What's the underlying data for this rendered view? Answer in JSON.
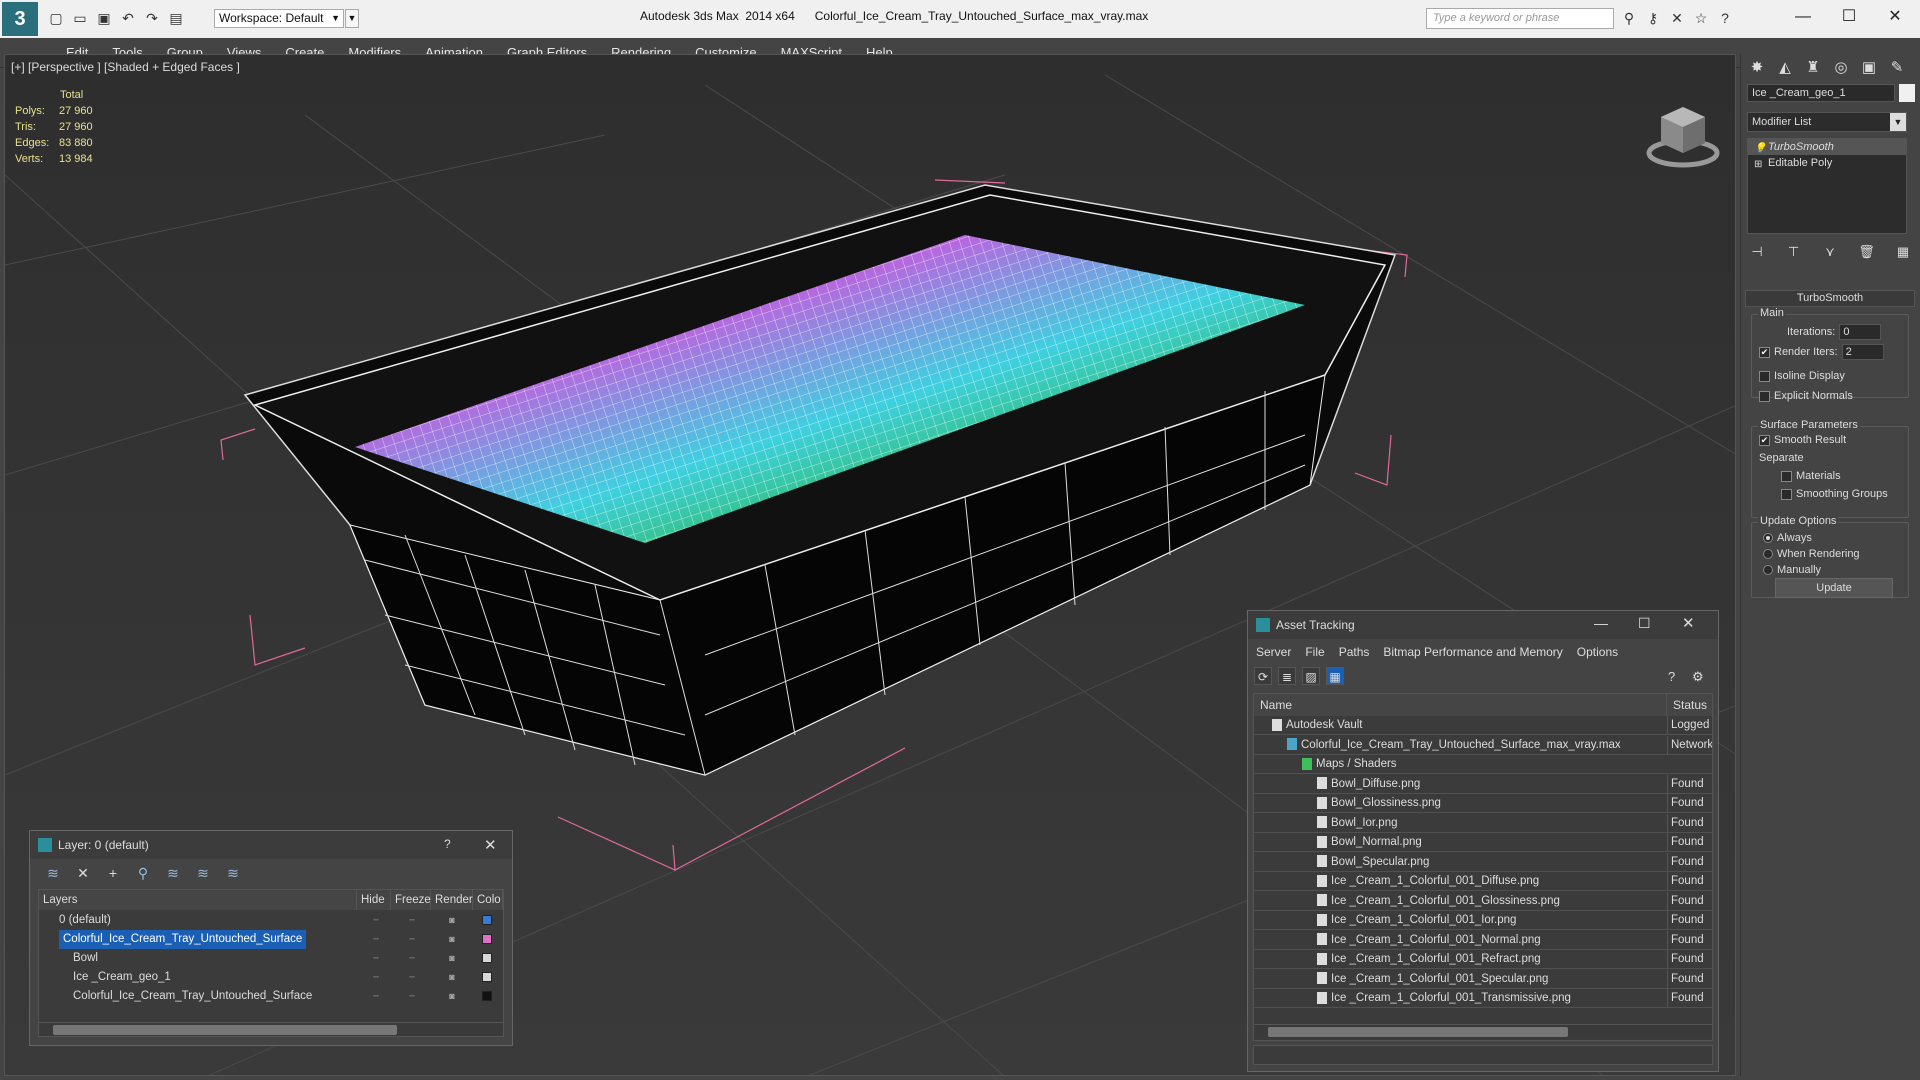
{
  "titlebar": {
    "workspace": "Workspace: Default",
    "app_title": "Autodesk 3ds Max  2014 x64      Colorful_Ice_Cream_Tray_Untouched_Surface_max_vray.max",
    "search_placeholder": "Type a keyword or phrase"
  },
  "menu": [
    "Edit",
    "Tools",
    "Group",
    "Views",
    "Create",
    "Modifiers",
    "Animation",
    "Graph Editors",
    "Rendering",
    "Customize",
    "MAXScript",
    "Help"
  ],
  "viewport": {
    "label": "[+] [Perspective ] [Shaded + Edged Faces ]",
    "stats_header": "Total",
    "stats": [
      {
        "label": "Polys:",
        "value": "27 960"
      },
      {
        "label": "Tris:",
        "value": "27 960"
      },
      {
        "label": "Edges:",
        "value": "83 880"
      },
      {
        "label": "Verts:",
        "value": "13 984"
      }
    ]
  },
  "command_panel": {
    "object_name": "Ice _Cream_geo_1",
    "modifier_list": "Modifier List",
    "stack": [
      "TurboSmooth",
      "Editable Poly"
    ],
    "rollout_title": "TurboSmooth",
    "main_group": "Main",
    "iterations_label": "Iterations:",
    "iterations_value": "0",
    "render_iters_label": "Render Iters:",
    "render_iters_value": "2",
    "isoline": "Isoline Display",
    "explicit_normals": "Explicit Normals",
    "surface_group": "Surface Parameters",
    "smooth_result": "Smooth Result",
    "separate": "Separate",
    "materials": "Materials",
    "smoothing_groups": "Smoothing Groups",
    "update_group": "Update Options",
    "always": "Always",
    "when_rendering": "When Rendering",
    "manually": "Manually",
    "update_button": "Update"
  },
  "asset_tracking": {
    "title": "Asset Tracking",
    "menu": [
      "Server",
      "File",
      "Paths",
      "Bitmap Performance and Memory",
      "Options"
    ],
    "col_name": "Name",
    "col_status": "Status",
    "rows": [
      {
        "name": "Autodesk Vault",
        "status": "Logged",
        "indent": 0
      },
      {
        "name": "Colorful_Ice_Cream_Tray_Untouched_Surface_max_vray.max",
        "status": "Network",
        "indent": 1
      },
      {
        "name": "Maps / Shaders",
        "status": "",
        "indent": 2
      },
      {
        "name": "Bowl_Diffuse.png",
        "status": "Found",
        "indent": 3
      },
      {
        "name": "Bowl_Glossiness.png",
        "status": "Found",
        "indent": 3
      },
      {
        "name": "Bowl_Ior.png",
        "status": "Found",
        "indent": 3
      },
      {
        "name": "Bowl_Normal.png",
        "status": "Found",
        "indent": 3
      },
      {
        "name": "Bowl_Specular.png",
        "status": "Found",
        "indent": 3
      },
      {
        "name": "Ice _Cream_1_Colorful_001_Diffuse.png",
        "status": "Found",
        "indent": 3
      },
      {
        "name": "Ice _Cream_1_Colorful_001_Glossiness.png",
        "status": "Found",
        "indent": 3
      },
      {
        "name": "Ice _Cream_1_Colorful_001_Ior.png",
        "status": "Found",
        "indent": 3
      },
      {
        "name": "Ice _Cream_1_Colorful_001_Normal.png",
        "status": "Found",
        "indent": 3
      },
      {
        "name": "Ice _Cream_1_Colorful_001_Refract.png",
        "status": "Found",
        "indent": 3
      },
      {
        "name": "Ice _Cream_1_Colorful_001_Specular.png",
        "status": "Found",
        "indent": 3
      },
      {
        "name": "Ice _Cream_1_Colorful_001_Transmissive.png",
        "status": "Found",
        "indent": 3
      }
    ]
  },
  "layer_dialog": {
    "title": "Layer: 0 (default)",
    "help": "?",
    "cols": [
      "Layers",
      "Hide",
      "Freeze",
      "Render",
      "Colo"
    ],
    "rows": [
      {
        "name": "0 (default)",
        "indent": 0,
        "color": "#3a7bd5",
        "selected": false
      },
      {
        "name": "Colorful_Ice_Cream_Tray_Untouched_Surface",
        "indent": 0,
        "color": "#e070c8",
        "selected": true
      },
      {
        "name": "Bowl",
        "indent": 1,
        "color": "#d8d8d8",
        "selected": false
      },
      {
        "name": "Ice _Cream_geo_1",
        "indent": 1,
        "color": "#d8d8d8",
        "selected": false
      },
      {
        "name": "Colorful_Ice_Cream_Tray_Untouched_Surface",
        "indent": 1,
        "color": "#111111",
        "selected": false
      }
    ]
  }
}
